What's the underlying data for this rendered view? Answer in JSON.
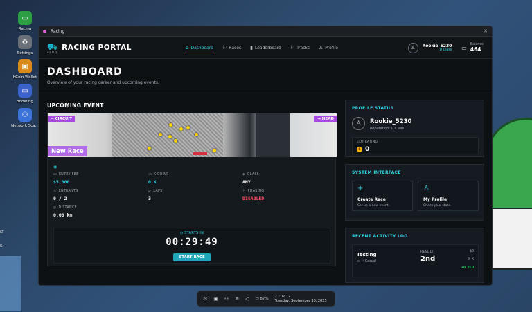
{
  "desktop": {
    "icons": [
      {
        "label": "Racing",
        "icon": "car-icon",
        "color": "#2e9e45",
        "glyph": "▭"
      },
      {
        "label": "Settings",
        "icon": "gear-icon",
        "color": "#6b7078",
        "glyph": "⚙"
      },
      {
        "label": "KCoin Wallet",
        "icon": "wallet-icon",
        "color": "#d98a1a",
        "glyph": "▣"
      },
      {
        "label": "Boosting",
        "icon": "laptop-icon",
        "color": "#3b63c9",
        "glyph": "▭"
      },
      {
        "label": "Network Sca...",
        "icon": "network-icon",
        "color": "#3b73d9",
        "glyph": "⚇"
      }
    ],
    "edge_labels": [
      "LT",
      "Si"
    ]
  },
  "window": {
    "title": "Racing",
    "close_glyph": "✕"
  },
  "app": {
    "brand": "RACING PORTAL",
    "version": "v1.0.0",
    "nav": [
      {
        "label": "Dashboard",
        "icon": "home-icon",
        "glyph": "⌂",
        "active": true
      },
      {
        "label": "Races",
        "icon": "flag-icon",
        "glyph": "⚐",
        "active": false
      },
      {
        "label": "Leaderboard",
        "icon": "bar-chart-icon",
        "glyph": "▮",
        "active": false
      },
      {
        "label": "Tracks",
        "icon": "flag-icon",
        "glyph": "⚐",
        "active": false
      },
      {
        "label": "Profile",
        "icon": "user-icon",
        "glyph": "♙",
        "active": false
      }
    ],
    "user": {
      "name": "Rookie_5230",
      "class": "D Class",
      "balance_label": "Balance",
      "balance": "464"
    }
  },
  "dashboard": {
    "title": "DASHBOARD",
    "subtitle": "Overview of your racing career and upcoming events.",
    "upcoming_title": "UPCOMING EVENT",
    "event": {
      "tag_left": "→ CIRCUIT",
      "tag_right": "→ HEAD",
      "name": "New Race",
      "stats": [
        {
          "label": "ENTRY FEE",
          "value": "$5,000",
          "icon": "ticket-icon",
          "glyph": "▭",
          "style": "cyan"
        },
        {
          "label": "K-COINS",
          "value": "0 K",
          "icon": "coin-icon",
          "glyph": "▭",
          "style": "cyan"
        },
        {
          "label": "CLASS",
          "value": "ANY",
          "icon": "shield-icon",
          "glyph": "◈",
          "style": "white"
        },
        {
          "label": "ENTRANTS",
          "value": "0 / 2",
          "icon": "users-icon",
          "glyph": "♙",
          "style": "white"
        },
        {
          "label": "LAPS",
          "value": "3",
          "icon": "refresh-icon",
          "glyph": "⟳",
          "style": "white"
        },
        {
          "label": "PHASING",
          "value": "DISABLED",
          "icon": "flag-icon",
          "glyph": "⚐",
          "style": "red"
        },
        {
          "label": "DISTANCE",
          "value": "0.00 km",
          "icon": "route-icon",
          "glyph": "◎",
          "style": "white"
        }
      ],
      "starts_in_label": "STARTS IN",
      "countdown": "00:29:49",
      "start_button": "START RACE"
    },
    "profile_status": {
      "title": "PROFILE STATUS",
      "name": "Rookie_5230",
      "reputation": "Reputation: D Class",
      "elo_label": "ELO RATING",
      "elo": "0"
    },
    "system_interface": {
      "title": "SYSTEM INTERFACE",
      "actions": [
        {
          "title": "Create Race",
          "sub": "Set up a new event.",
          "icon": "plus-icon",
          "glyph": "+"
        },
        {
          "title": "My Profile",
          "sub": "Check your stats.",
          "icon": "user-icon",
          "glyph": "♙"
        }
      ]
    },
    "activity": {
      "title": "RECENT ACTIVITY LOG",
      "items": [
        {
          "name": "Testing",
          "type": "Casual",
          "result_label": "RESULT",
          "place": "2nd",
          "money": "$0",
          "coins": "0 K",
          "elo": "+0 ELO"
        }
      ]
    }
  },
  "taskbar": {
    "battery": "87%",
    "time": "21:02:12",
    "date": "Tuesday, September 30, 2025"
  }
}
